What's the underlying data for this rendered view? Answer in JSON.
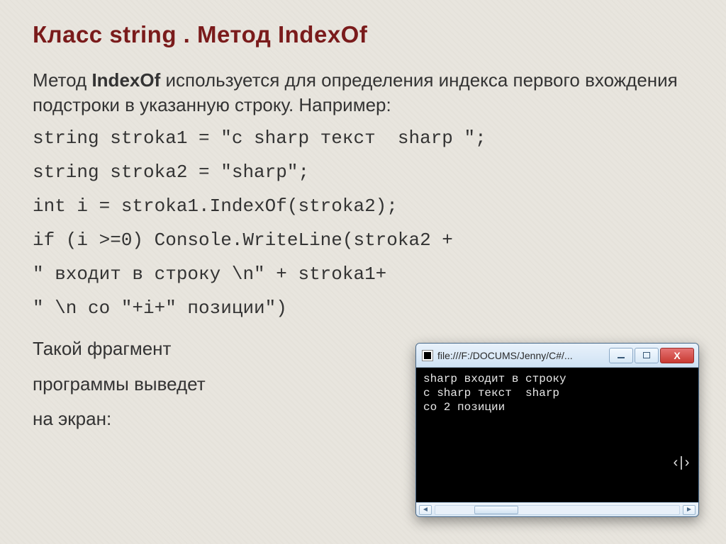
{
  "title": "Класс string . Метод IndexOf",
  "intro_prefix": "Метод ",
  "intro_bold": "IndexOf",
  "intro_suffix": " используется для определения индекса первого вхождения подстроки в указанную строку. Например:",
  "code": {
    "l1": "string stroka1 = \"c sharp текст  sharp \";",
    "l2": "string stroka2 = \"sharp\";",
    "l3": "int i = stroka1.IndexOf(stroka2);",
    "l4": "if (i >=0) Console.WriteLine(stroka2 +",
    "l5": "\" входит в строку \\n\" + stroka1+",
    "l6": "\" \\n со \"+i+\" позиции\")"
  },
  "outro": {
    "l1": "Такой фрагмент",
    "l2": "программы выведет",
    "l3": "на экран:"
  },
  "window": {
    "title": "file:///F:/DOCUMS/Jenny/C#/...",
    "close_glyph": "X",
    "console_line1": "sharp входит в строку",
    "console_line2": "c sharp текст  sharp",
    "console_line3": "со 2 позиции",
    "cursor_glyph": "‹|›",
    "scroll_left": "◄",
    "scroll_right": "►"
  }
}
